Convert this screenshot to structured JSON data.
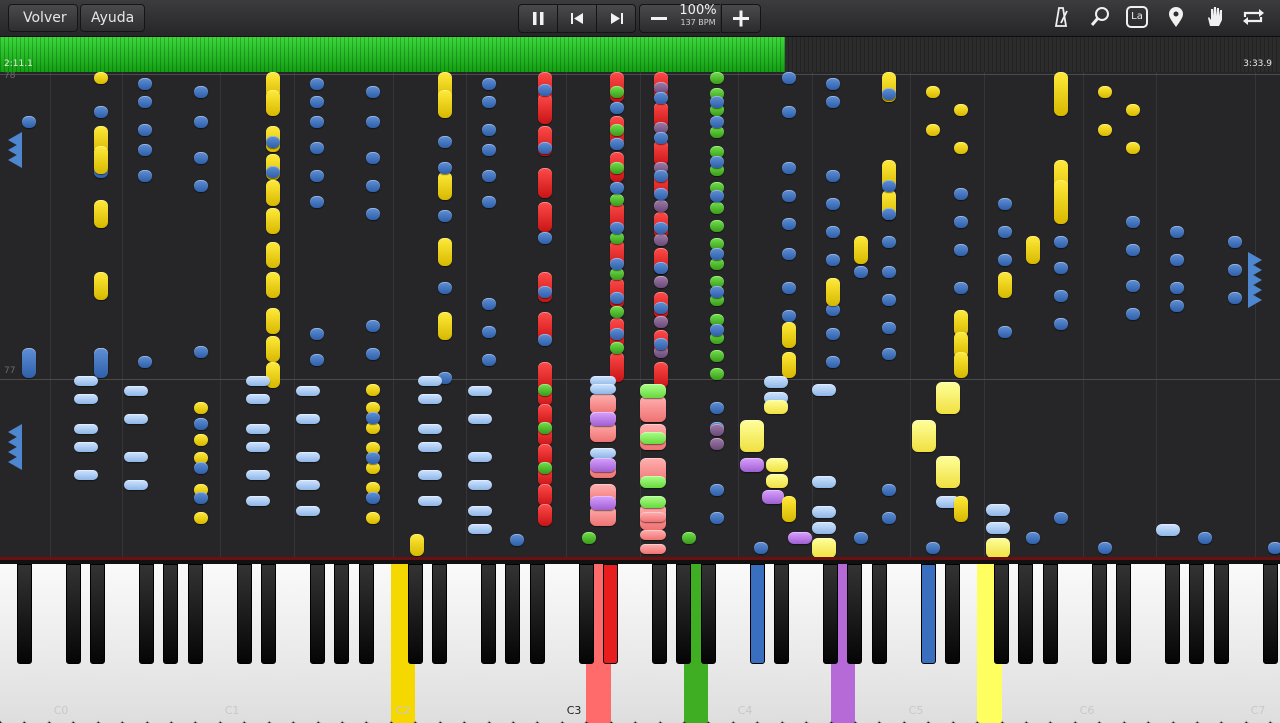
{
  "toolbar": {
    "back_label": "Volver",
    "help_label": "Ayuda",
    "play_state_icon": "pause-icon",
    "prev_icon": "skip-back-icon",
    "next_icon": "skip-forward-icon",
    "speed_percent": "100%",
    "speed_bpm": "137 BPM",
    "right_icons": [
      "metronome-icon",
      "magnifier-icon",
      "note-label-icon",
      "location-pin-icon",
      "hand-icon",
      "loop-icon"
    ],
    "note_label_glyph": "La"
  },
  "progress": {
    "current_time": "2:11.1",
    "total_time": "3:33.9",
    "fraction": 0.613,
    "color": "#22c022"
  },
  "field": {
    "measures": [
      "78",
      "77"
    ]
  },
  "keyboard": {
    "octave_labels": [
      "C0",
      "C1",
      "C2",
      "C3",
      "C4",
      "C5",
      "C6",
      "C7"
    ],
    "active_colors": {
      "yellow": "#f5d800",
      "red": "#e81e1e",
      "blue": "#3a6fc0",
      "pink": "#ff6a6a",
      "green": "#3fae22",
      "violet": "#b56ad8",
      "lightyellow": "#ffff60"
    }
  }
}
